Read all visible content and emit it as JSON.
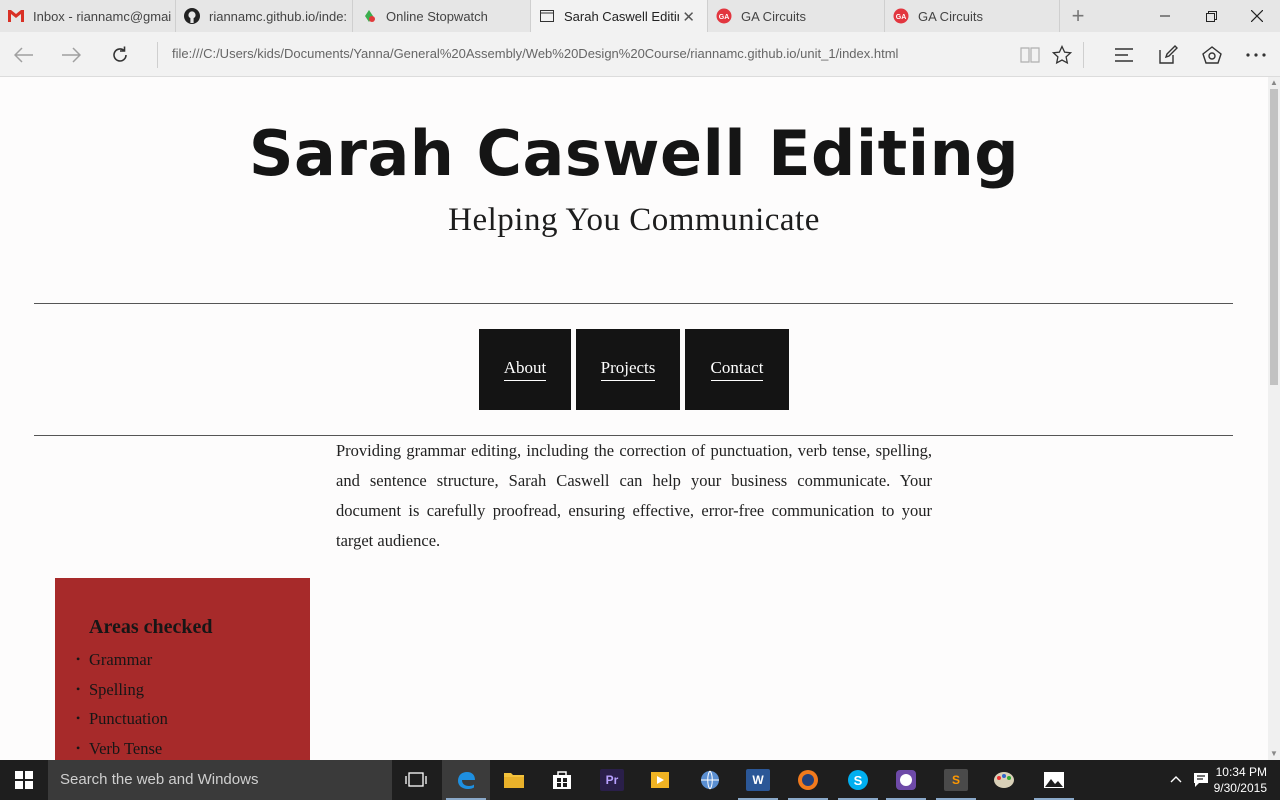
{
  "tabs": [
    {
      "title": "Inbox - riannamc@gmai",
      "icon": "gmail-icon",
      "active": false
    },
    {
      "title": "riannamc.github.io/inde:",
      "icon": "github-icon",
      "active": false
    },
    {
      "title": "Online Stopwatch",
      "icon": "stopwatch-icon",
      "active": false
    },
    {
      "title": "Sarah Caswell Editin",
      "icon": "page-icon",
      "active": true
    },
    {
      "title": "GA Circuits",
      "icon": "ga-icon",
      "active": false
    },
    {
      "title": "GA Circuits",
      "icon": "ga-icon",
      "active": false
    }
  ],
  "address": {
    "url": "file:///C:/Users/kids/Documents/Yanna/General%20Assembly/Web%20Design%20Course/riannamc.github.io/unit_1/index.html"
  },
  "page": {
    "title": "Sarah Caswell Editing",
    "tagline": "Helping You Communicate",
    "nav": [
      {
        "label": "About"
      },
      {
        "label": "Projects"
      },
      {
        "label": "Contact"
      }
    ],
    "intro": "Providing grammar editing, including the correction of punctuation, verb tense, spelling, and sentence structure, Sarah Caswell can help your business communicate. Your document is carefully proofread, ensuring effective, error-free communication to your target audience.",
    "aside": {
      "heading": "Areas checked",
      "items": [
        "Grammar",
        "Spelling",
        "Punctuation",
        "Verb Tense"
      ]
    }
  },
  "taskbar": {
    "search_placeholder": "Search the web and Windows",
    "time": "10:34 PM",
    "date": "9/30/2015"
  },
  "colors": {
    "aside_bg": "#a72a2a",
    "nav_bg": "#141414",
    "gmail_red": "#d93025",
    "ga_red": "#e2363f"
  }
}
